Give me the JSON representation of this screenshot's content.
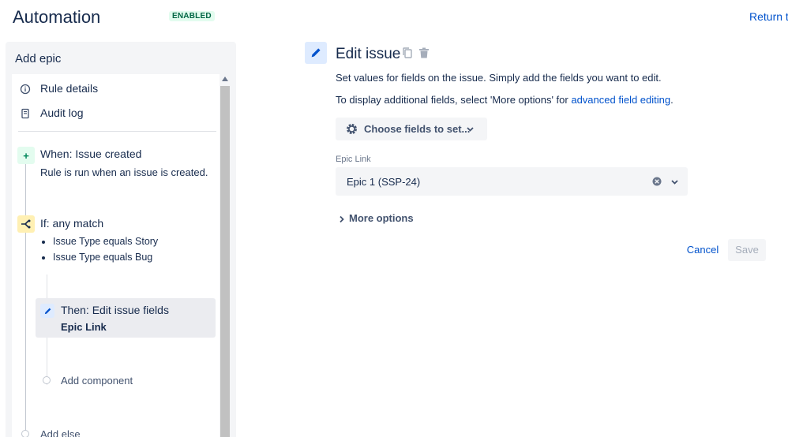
{
  "header": {
    "title": "Automation",
    "status_badge": "ENABLED",
    "return_link": "Return to"
  },
  "sidebar": {
    "title": "Add epic",
    "nav_items": [
      {
        "label": "Rule details",
        "icon": "info-icon"
      },
      {
        "label": "Audit log",
        "icon": "document-icon"
      }
    ],
    "trigger": {
      "title": "When: Issue created",
      "description": "Rule is run when an issue is created."
    },
    "condition": {
      "title": "If: any match",
      "bullets": [
        "Issue Type equals Story",
        "Issue Type equals Bug"
      ]
    },
    "action": {
      "title": "Then: Edit issue fields",
      "subtitle": "Epic Link"
    },
    "add_component": "Add component",
    "add_else": "Add else"
  },
  "editor": {
    "title": "Edit issue",
    "description": "Set values for fields on the issue. Simply add the fields you want to edit.",
    "hint_prefix": "To display additional fields, select 'More options' for ",
    "hint_link": "advanced field editing",
    "hint_suffix": ".",
    "choose_fields_label": "Choose fields to set...",
    "field_label": "Epic Link",
    "field_value": "Epic 1 (SSP-24)",
    "more_options": "More options",
    "cancel": "Cancel",
    "save": "Save"
  },
  "colors": {
    "accent": "#0052cc",
    "badge_green": "#006644",
    "badge_bg": "#e3fcef",
    "text": "#172b4d"
  }
}
